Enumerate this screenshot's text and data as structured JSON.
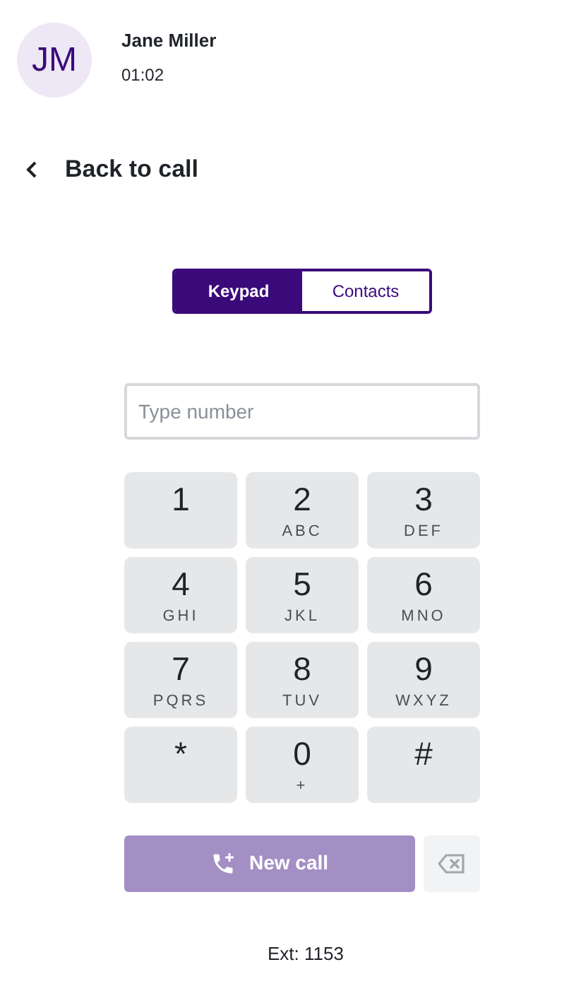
{
  "caller": {
    "initials": "JM",
    "name": "Jane Miller",
    "duration": "01:02"
  },
  "back": {
    "label": "Back to call"
  },
  "tabs": [
    {
      "label": "Keypad",
      "selected": true
    },
    {
      "label": "Contacts",
      "selected": false
    }
  ],
  "number_field": {
    "placeholder": "Type number"
  },
  "keys": [
    {
      "digit": "1"
    },
    {
      "digit": "2",
      "letters": "ABC"
    },
    {
      "digit": "3",
      "letters": "DEF"
    },
    {
      "digit": "4",
      "letters": "GHI"
    },
    {
      "digit": "5",
      "letters": "JKL"
    },
    {
      "digit": "6",
      "letters": "MNO"
    },
    {
      "digit": "7",
      "letters": "PQRS"
    },
    {
      "digit": "8",
      "letters": "TUV"
    },
    {
      "digit": "9",
      "letters": "WXYZ"
    },
    {
      "digit": "*"
    },
    {
      "digit": "0",
      "letters": "+"
    },
    {
      "digit": "#"
    }
  ],
  "new_call": {
    "label": "New call",
    "disabled": true
  },
  "backspace": {
    "disabled": true
  },
  "extension": "Ext: 1153"
}
